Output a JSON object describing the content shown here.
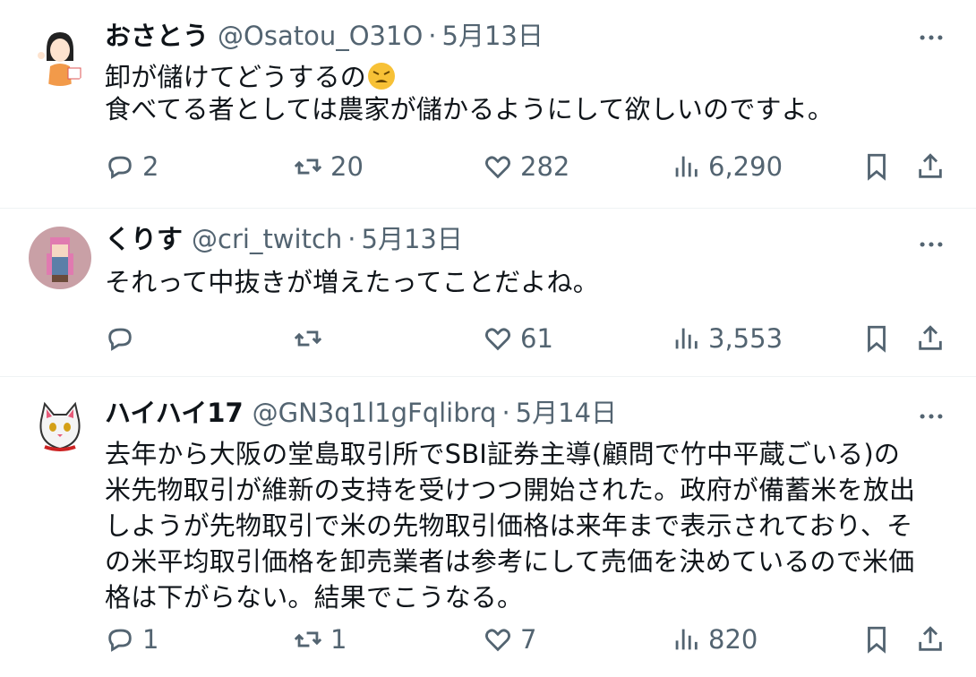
{
  "tweets": [
    {
      "name": "おさとう",
      "handle": "@Osatou_O31O",
      "date": "5月13日",
      "lines": [
        "卸が儲けてどうするの",
        "食べてる者としては農家が儲かるようにして欲しいのですよ。"
      ],
      "emoji": "weary-face-emoji",
      "replies": "2",
      "retweets": "20",
      "likes": "282",
      "views": "6,290"
    },
    {
      "name": "くりす",
      "handle": "@cri_twitch",
      "date": "5月13日",
      "lines": [
        "それって中抜きが増えたってことだよね。"
      ],
      "replies": "",
      "retweets": "",
      "likes": "61",
      "views": "3,553"
    },
    {
      "name": "ハイハイ17",
      "handle": "@GN3q1l1gFqlibrq",
      "date": "5月14日",
      "lines": [
        "去年から大阪の堂島取引所でSBI証券主導(顧問で竹中平蔵ごいる)の",
        "米先物取引が維新の支持を受けつつ開始された。政府が備蓄米を放出",
        "しようが先物取引で米の先物取引価格は来年まで表示されており、そ",
        "の米平均取引価格を卸売業者は参考にして売価を決めているので米価",
        "格は下がらない。結果でこうなる。"
      ],
      "replies": "1",
      "retweets": "1",
      "likes": "7",
      "views": "820"
    }
  ],
  "separator_dot": "·",
  "colors": {
    "text": "#0f1419",
    "secondary": "#536471",
    "divider": "#eff3f4"
  },
  "icons": [
    "reply-icon",
    "retweet-icon",
    "like-icon",
    "views-icon",
    "bookmark-icon",
    "share-icon",
    "more-icon"
  ]
}
